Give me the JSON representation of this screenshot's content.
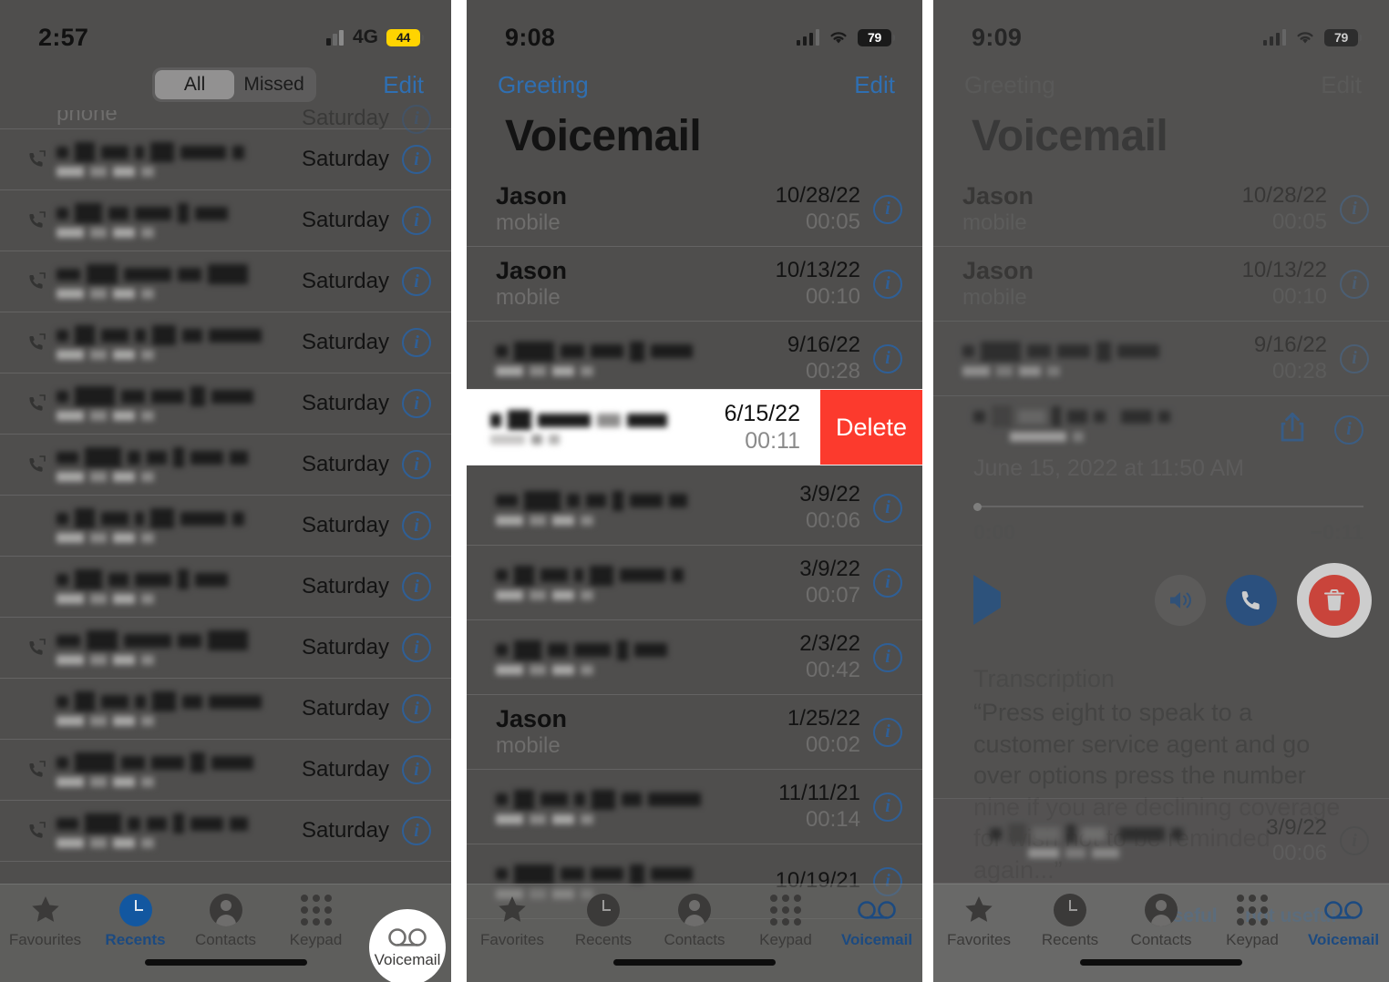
{
  "panels": [
    {
      "id": "recents",
      "status": {
        "time": "2:57",
        "network": "4G",
        "battery": "44"
      },
      "nav": {
        "segments": [
          "All",
          "Missed"
        ],
        "selected": "All",
        "edit_label": "Edit"
      },
      "partial_row_label": "phone",
      "rows": [
        {
          "date": "Saturday"
        },
        {
          "date": "Saturday"
        },
        {
          "date": "Saturday"
        },
        {
          "date": "Saturday"
        },
        {
          "date": "Saturday"
        },
        {
          "date": "Saturday"
        },
        {
          "date": "Saturday"
        },
        {
          "date": "Saturday"
        },
        {
          "date": "Saturday"
        },
        {
          "date": "Saturday"
        },
        {
          "date": "Saturday"
        },
        {
          "date": "Saturday"
        }
      ],
      "tabs": [
        {
          "label": "Favourites",
          "icon": "star-icon",
          "active": false
        },
        {
          "label": "Recents",
          "icon": "clock-icon",
          "active": true
        },
        {
          "label": "Contacts",
          "icon": "person-icon",
          "active": false
        },
        {
          "label": "Keypad",
          "icon": "keypad-icon",
          "active": false
        },
        {
          "label": "Voicemail",
          "icon": "voicemail-icon",
          "active": false,
          "highlighted": true
        }
      ]
    },
    {
      "id": "voicemail-list",
      "status": {
        "time": "9:08",
        "battery": "79"
      },
      "nav": {
        "left_label": "Greeting",
        "right_label": "Edit"
      },
      "title": "Voicemail",
      "rows": [
        {
          "name": "Jason",
          "sub": "mobile",
          "date": "10/28/22",
          "duration": "00:05",
          "redacted": false
        },
        {
          "name": "Jason",
          "sub": "mobile",
          "date": "10/13/22",
          "duration": "00:10",
          "redacted": false
        },
        {
          "name": "",
          "sub": "",
          "date": "9/16/22",
          "duration": "00:28",
          "redacted": true
        },
        {
          "name": "",
          "sub": "",
          "date": "3/9/22",
          "duration": "00:06",
          "redacted": true
        },
        {
          "name": "",
          "sub": "",
          "date": "3/9/22",
          "duration": "00:07",
          "redacted": true
        },
        {
          "name": "",
          "sub": "",
          "date": "2/3/22",
          "duration": "00:42",
          "redacted": true
        },
        {
          "name": "Jason",
          "sub": "mobile",
          "date": "1/25/22",
          "duration": "00:02",
          "redacted": false
        },
        {
          "name": "",
          "sub": "",
          "date": "11/11/21",
          "duration": "00:14",
          "redacted": true
        },
        {
          "name": "",
          "sub": "",
          "date": "10/19/21",
          "duration": "",
          "redacted": true
        }
      ],
      "swipe_row": {
        "date": "6/15/22",
        "duration": "00:11",
        "delete_label": "Delete"
      },
      "tabs": [
        {
          "label": "Favorites",
          "icon": "star-icon",
          "active": false
        },
        {
          "label": "Recents",
          "icon": "clock-icon",
          "active": false
        },
        {
          "label": "Contacts",
          "icon": "person-icon",
          "active": false
        },
        {
          "label": "Keypad",
          "icon": "keypad-icon",
          "active": false
        },
        {
          "label": "Voicemail",
          "icon": "voicemail-icon",
          "active": true
        }
      ]
    },
    {
      "id": "voicemail-detail",
      "status": {
        "time": "9:09",
        "battery": "79"
      },
      "nav": {
        "left_label": "Greeting",
        "right_label": "Edit"
      },
      "title": "Voicemail",
      "rows": [
        {
          "name": "Jason",
          "sub": "mobile",
          "date": "10/28/22",
          "duration": "00:05",
          "redacted": false
        },
        {
          "name": "Jason",
          "sub": "mobile",
          "date": "10/13/22",
          "duration": "00:10",
          "redacted": false
        },
        {
          "name": "",
          "sub": "",
          "date": "9/16/22",
          "duration": "00:28",
          "redacted": true
        }
      ],
      "detail": {
        "date": "June 15, 2022 at 11:50 AM",
        "elapsed": "0:00",
        "remaining": "−0:11",
        "transcription_heading": "Transcription",
        "transcription_text": "“Press eight to speak to a customer service agent and go over options press the number nine if you are declining coverage for wish not to be reminded again...”",
        "feedback_prefix": "Was this transcription ",
        "feedback_useful": "useful",
        "feedback_middle": " or ",
        "feedback_not_useful": "not useful",
        "feedback_suffix": "?",
        "share_icon": "share-icon",
        "info_icon": "info-icon",
        "play_icon": "play-icon",
        "speaker_icon": "speaker-icon",
        "call_icon": "phone-icon",
        "delete_icon": "trash-icon"
      },
      "bottom_row": {
        "date": "3/9/22",
        "duration": "00:06"
      },
      "tabs": [
        {
          "label": "Favorites",
          "icon": "star-icon",
          "active": false
        },
        {
          "label": "Recents",
          "icon": "clock-icon",
          "active": false
        },
        {
          "label": "Contacts",
          "icon": "person-icon",
          "active": false
        },
        {
          "label": "Keypad",
          "icon": "keypad-icon",
          "active": false
        },
        {
          "label": "Voicemail",
          "icon": "voicemail-icon",
          "active": true
        }
      ]
    }
  ],
  "colors": {
    "delete_red": "#fc3a2d",
    "ios_blue": "#2f6fb2",
    "accent_dark_blue": "#174c8f",
    "dim_background": "#4f4e4d"
  }
}
